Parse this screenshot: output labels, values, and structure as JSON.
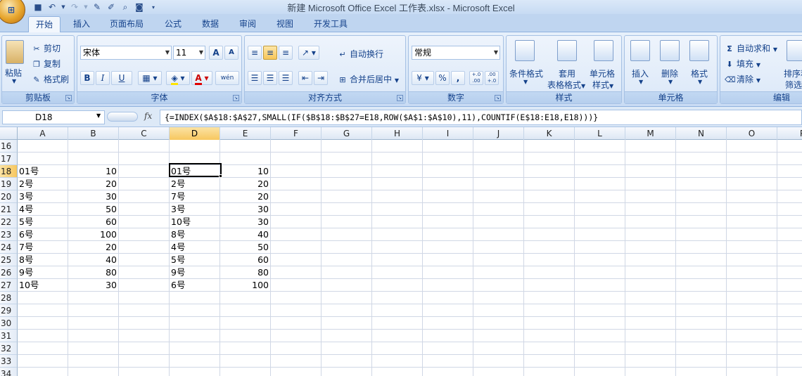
{
  "window": {
    "title": "新建 Microsoft Office Excel 工作表.xlsx - Microsoft Excel"
  },
  "qat": {
    "save_icon": "save-icon",
    "undo_icon": "undo-icon",
    "redo_icon": "redo-icon",
    "customize_icon": "dropdown-icon"
  },
  "tabs": [
    {
      "label": "开始",
      "active": true
    },
    {
      "label": "插入"
    },
    {
      "label": "页面布局"
    },
    {
      "label": "公式"
    },
    {
      "label": "数据"
    },
    {
      "label": "审阅"
    },
    {
      "label": "视图"
    },
    {
      "label": "开发工具"
    }
  ],
  "ribbon": {
    "clipboard": {
      "label": "剪贴板",
      "paste": "粘贴",
      "cut": "剪切",
      "copy": "复制",
      "format_painter": "格式刷"
    },
    "font": {
      "label": "字体",
      "font_name": "宋体",
      "font_size": "11",
      "bold": "B",
      "italic": "I",
      "underline": "U",
      "grow": "A",
      "shrink": "A",
      "font_color": "A",
      "phonetic": "wén"
    },
    "alignment": {
      "label": "对齐方式",
      "wrap": "自动换行",
      "merge": "合并后居中"
    },
    "number": {
      "label": "数字",
      "format": "常规",
      "percent": "%",
      "comma": ",",
      "inc_decimal": "+.0 .00",
      "dec_decimal": ".00 +.0"
    },
    "styles": {
      "label": "样式",
      "conditional": "条件格式",
      "table_line1": "套用",
      "table_line2": "表格格式",
      "cell_styles_line1": "单元格",
      "cell_styles_line2": "样式"
    },
    "cells": {
      "label": "单元格",
      "insert": "插入",
      "delete": "删除",
      "format": "格式"
    },
    "editing": {
      "label": "编辑",
      "autosum": "自动求和",
      "fill": "填充",
      "clear": "清除",
      "sort_line1": "排序和",
      "sort_line2": "筛选"
    }
  },
  "formula_bar": {
    "name_box": "D18",
    "fx": "fx",
    "formula": "{=INDEX($A$18:$A$27,SMALL(IF($B$18:$B$27=E18,ROW($A$1:$A$10),11),COUNTIF(E$18:E18,E18)))}"
  },
  "sheet": {
    "columns": [
      "A",
      "B",
      "C",
      "D",
      "E",
      "F",
      "G",
      "H",
      "I",
      "J",
      "K",
      "L",
      "M",
      "N",
      "O",
      "P"
    ],
    "selected_column": "D",
    "rows": [
      "16",
      "17",
      "18",
      "19",
      "20",
      "21",
      "22",
      "23",
      "24",
      "25",
      "26",
      "27",
      "28",
      "29",
      "30",
      "31",
      "32",
      "33",
      "34"
    ],
    "selected_row": "18",
    "data": [
      {
        "row": "18",
        "A": "01号",
        "B": "10",
        "D": "01号",
        "E": "10"
      },
      {
        "row": "19",
        "A": "2号",
        "B": "20",
        "D": "2号",
        "E": "20"
      },
      {
        "row": "20",
        "A": "3号",
        "B": "30",
        "D": "7号",
        "E": "20"
      },
      {
        "row": "21",
        "A": "4号",
        "B": "50",
        "D": "3号",
        "E": "30"
      },
      {
        "row": "22",
        "A": "5号",
        "B": "60",
        "D": "10号",
        "E": "30"
      },
      {
        "row": "23",
        "A": "6号",
        "B": "100",
        "D": "8号",
        "E": "40"
      },
      {
        "row": "24",
        "A": "7号",
        "B": "20",
        "D": "4号",
        "E": "50"
      },
      {
        "row": "25",
        "A": "8号",
        "B": "40",
        "D": "5号",
        "E": "60"
      },
      {
        "row": "26",
        "A": "9号",
        "B": "80",
        "D": "9号",
        "E": "80"
      },
      {
        "row": "27",
        "A": "10号",
        "B": "30",
        "D": "6号",
        "E": "100"
      }
    ]
  }
}
